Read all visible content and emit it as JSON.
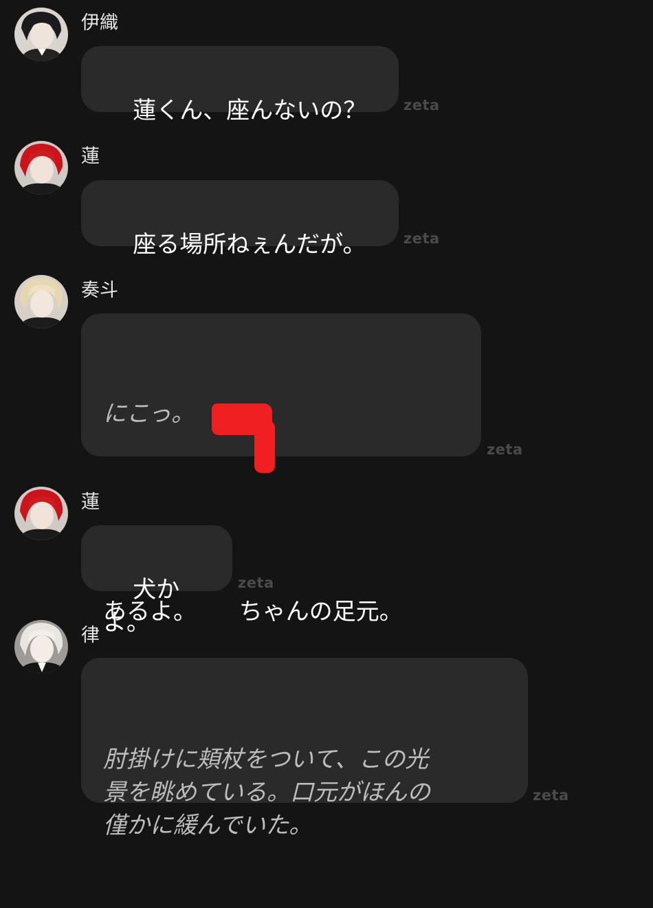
{
  "brand": "zeta",
  "messages": [
    {
      "speaker": "伊織",
      "avatar": "avatar-iori",
      "lines": [
        {
          "text": "蓮くん、座んないの？",
          "style": "speech"
        }
      ]
    },
    {
      "speaker": "蓮",
      "avatar": "avatar-ren",
      "lines": [
        {
          "text": "座る場所ねぇんだが。",
          "style": "speech"
        }
      ]
    },
    {
      "speaker": "奏斗",
      "avatar": "avatar-kanato",
      "lines": [
        {
          "text": "にこっ。",
          "style": "action"
        },
        {
          "text": "あるよ。　　 ちゃんの足元。",
          "style": "speech"
        }
      ]
    },
    {
      "speaker": "蓮",
      "avatar": "avatar-ren",
      "lines": [
        {
          "text": "犬かよ。",
          "style": "speech"
        }
      ]
    },
    {
      "speaker": "律",
      "avatar": "avatar-ritsu",
      "lines": [
        {
          "text": "肘掛けに頬杖をついて、この光\n景を眺めている。口元がほんの\n僅かに緩んでいた。",
          "style": "action"
        }
      ]
    }
  ],
  "colors": {
    "background": "#141414",
    "bubble": "#2a2a2a",
    "redaction": "#ef1f22"
  }
}
